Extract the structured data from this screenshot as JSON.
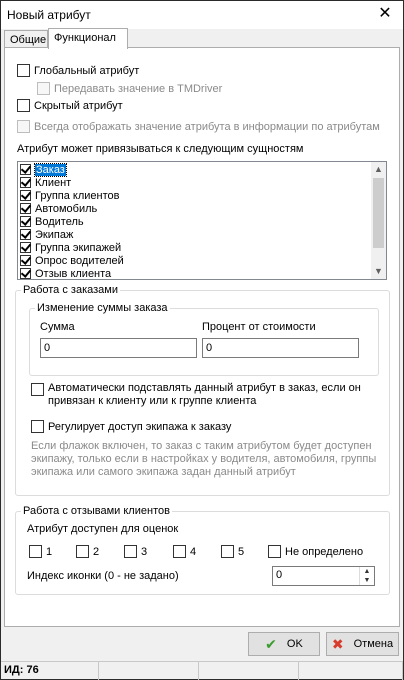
{
  "window": {
    "title": "Новый атрибут",
    "close_icon": "close-icon"
  },
  "tabs": [
    {
      "label": "Общие"
    },
    {
      "label": "Функционал"
    }
  ],
  "options": {
    "global_attr": "Глобальный атрибут",
    "pass_to_tmdriver": "Передавать значение в TMDriver",
    "hidden_attr": "Скрытый атрибут",
    "always_show": "Всегда отображать значение атрибута в информации по атрибутам"
  },
  "entities": {
    "label": "Атрибут может привязываться к следующим сущностям",
    "items": [
      {
        "label": "Заказ",
        "checked": true,
        "selected": true
      },
      {
        "label": "Клиент",
        "checked": true
      },
      {
        "label": "Группа клиентов",
        "checked": true
      },
      {
        "label": "Автомобиль",
        "checked": true
      },
      {
        "label": "Водитель",
        "checked": true
      },
      {
        "label": "Экипаж",
        "checked": true
      },
      {
        "label": "Группа экипажей",
        "checked": true
      },
      {
        "label": "Опрос водителей",
        "checked": true
      },
      {
        "label": "Отзыв клиента",
        "checked": true
      }
    ]
  },
  "orders": {
    "group_title": "Работа с заказами",
    "sum_change_title": "Изменение суммы заказа",
    "sum_label": "Сумма",
    "sum_value": "0",
    "percent_label": "Процент от стоимости",
    "percent_value": "0",
    "auto_substitute": "Автоматически подставлять данный атрибут в заказ, если он привязан к клиенту или к группе клиента",
    "regulate_access": "Регулирует доступ экипажа к заказу",
    "regulate_hint": "Если флажок включен, то заказ с таким атрибутом будет доступен экипажу, только если в настройках у водителя, автомобиля, группы экипажа или самого экипажа задан данный атрибут"
  },
  "reviews": {
    "group_title": "Работа с отзывами клиентов",
    "ratings_label": "Атрибут доступен для оценок",
    "ratings": [
      "1",
      "2",
      "3",
      "4",
      "5"
    ],
    "undefined_label": "Не определено",
    "icon_index_label": "Индекс иконки (0 - не задано)",
    "icon_index_value": "0"
  },
  "buttons": {
    "ok": "OK",
    "cancel": "Отмена"
  },
  "status": {
    "id_text": "ИД: 76"
  },
  "colors": {
    "selection": "#0078d7",
    "ok_icon": "#3a9b2e",
    "cancel_icon": "#d83b2b"
  }
}
